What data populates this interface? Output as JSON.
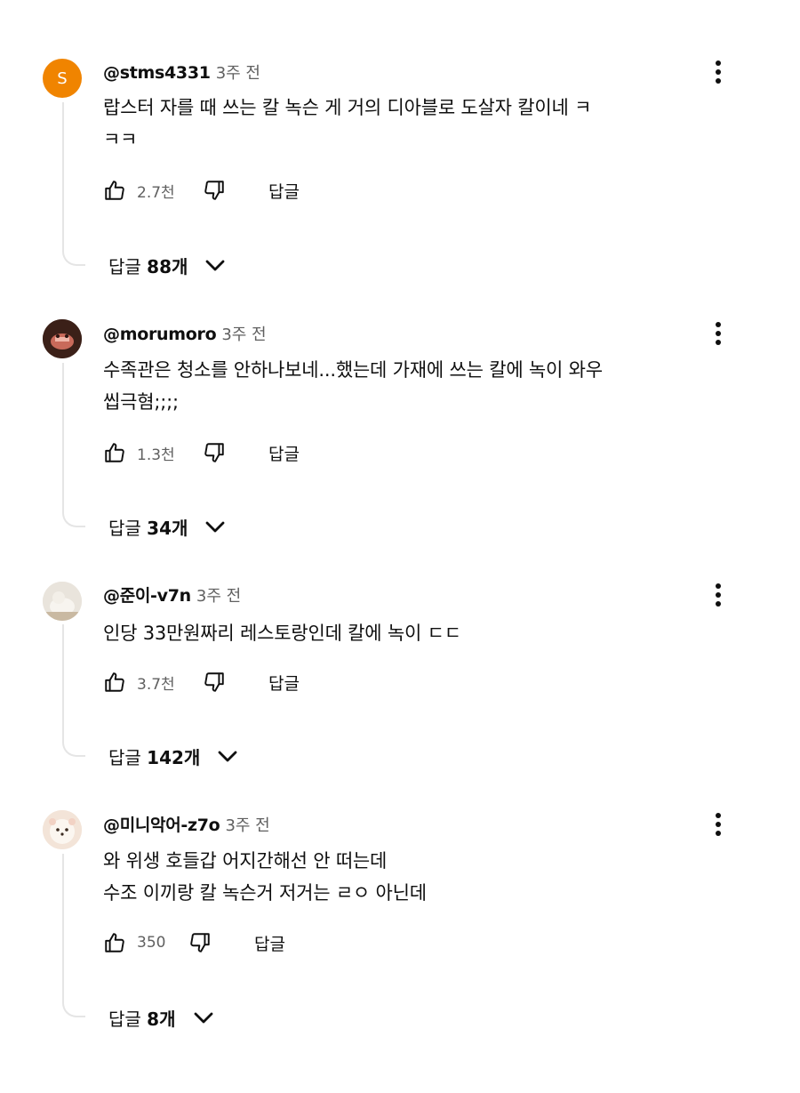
{
  "comments": [
    {
      "username": "@stms4331",
      "time": "3주 전",
      "avatar_letter": "S",
      "avatar_color": "#f08400",
      "lines": [
        "랍스터 자를 때 쓰는 칼 녹슨 게 거의 디아블로 도살자 칼이네 ㅋ",
        "ㅋㅋ"
      ],
      "likes": "2.7천",
      "reply_label": "답글",
      "replies_label": "답글",
      "replies_count": "88개"
    },
    {
      "username": "@morumoro",
      "time": "3주 전",
      "lines": [
        "수족관은 청소를 안하나보네...했는데 가재에 쓰는 칼에 녹이 와우",
        "씹극혐;;;;"
      ],
      "likes": "1.3천",
      "reply_label": "답글",
      "replies_label": "답글",
      "replies_count": "34개"
    },
    {
      "username": "@준이-v7n",
      "time": "3주 전",
      "lines": [
        "인당 33만원짜리 레스토랑인데 칼에 녹이 ㄷㄷ"
      ],
      "likes": "3.7천",
      "reply_label": "답글",
      "replies_label": "답글",
      "replies_count": "142개"
    },
    {
      "username": "@미니악어-z7o",
      "time": "3주 전",
      "lines": [
        "와 위생 호들갑 어지간해선 안 떠는데",
        "수조 이끼랑 칼 녹슨거 저거는 ㄹㅇ 아닌데"
      ],
      "likes": "350",
      "reply_label": "답글",
      "replies_label": "답글",
      "replies_count": "8개"
    }
  ]
}
